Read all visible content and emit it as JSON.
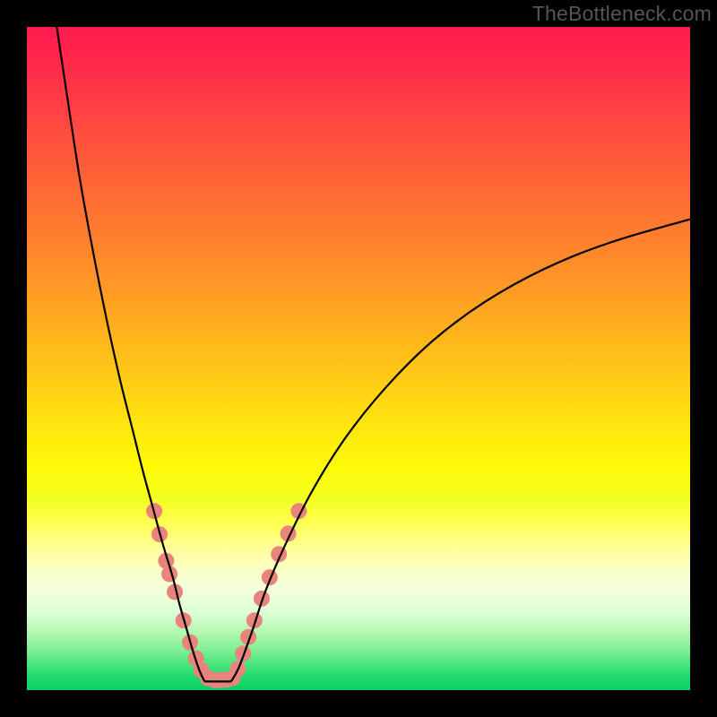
{
  "watermark": "TheBottleneck.com",
  "chart_data": {
    "type": "line",
    "title": "",
    "xlabel": "",
    "ylabel": "",
    "xlim": [
      0,
      100
    ],
    "ylim": [
      0,
      100
    ],
    "notes": "Bottleneck-style V curve. Axes are unlabeled; values are percent positions read off the plot area. 'left' and 'right' are the two black curve branches meeting at a flat floor. 'dots_left' and 'dots_right' are the salmon marker clusters on each branch.",
    "series": [
      {
        "name": "left",
        "x": [
          4.5,
          6,
          8,
          10,
          12,
          14,
          16,
          17.5,
          19,
          20.5,
          22,
          23,
          24,
          25,
          26,
          26.8
        ],
        "y": [
          100,
          90,
          77,
          66,
          56,
          47,
          39,
          33,
          27.5,
          22,
          17,
          13,
          9.5,
          6,
          3,
          1.3
        ]
      },
      {
        "name": "floor",
        "x": [
          26.8,
          30.8
        ],
        "y": [
          1.3,
          1.3
        ]
      },
      {
        "name": "right",
        "x": [
          30.8,
          32,
          34,
          36,
          39,
          43,
          48,
          54,
          61,
          69,
          78,
          88,
          100
        ],
        "y": [
          1.3,
          3.5,
          9,
          15,
          22,
          30,
          38,
          45.5,
          52.5,
          58.5,
          63.5,
          67.5,
          71
        ]
      }
    ],
    "dots_left": {
      "x": [
        19.2,
        20.0,
        21.0,
        21.5,
        22.3,
        23.6,
        24.6,
        25.5,
        26.3,
        27.3,
        28.3,
        29.3,
        30.2
      ],
      "y": [
        27.0,
        23.5,
        19.5,
        17.5,
        14.8,
        10.5,
        7.2,
        4.8,
        3.0,
        1.8,
        1.5,
        1.5,
        1.6
      ]
    },
    "dots_right": {
      "x": [
        31.0,
        31.8,
        32.6,
        33.4,
        34.3,
        35.4,
        36.6,
        38.0,
        39.4,
        41.0
      ],
      "y": [
        1.8,
        3.2,
        5.5,
        8.0,
        10.5,
        13.8,
        17.0,
        20.5,
        23.6,
        27.0
      ]
    },
    "dot_color": "#e9847d",
    "curve_color": "#000000"
  }
}
